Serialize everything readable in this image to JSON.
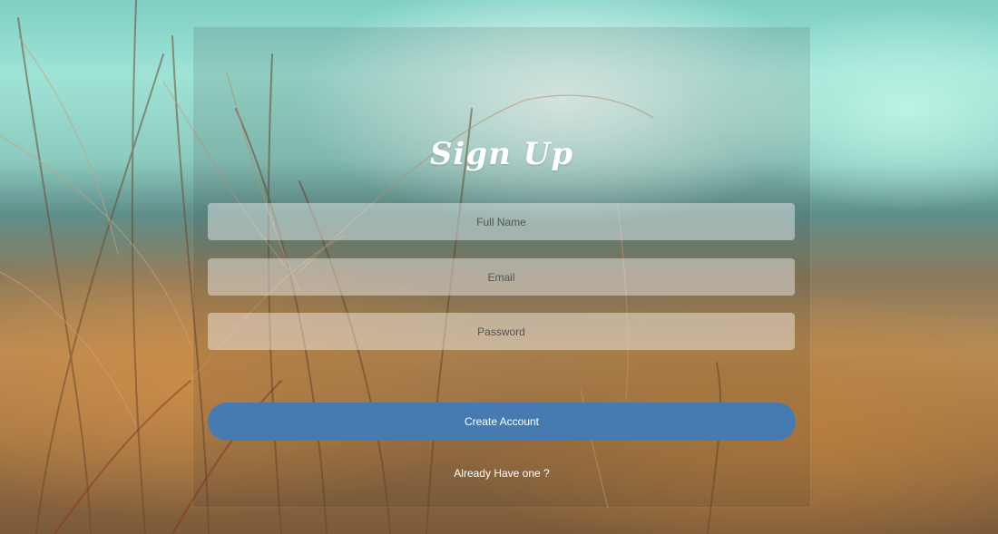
{
  "form": {
    "title": "Sign Up",
    "full_name": {
      "placeholder": "Full Name",
      "value": ""
    },
    "email": {
      "placeholder": "Email",
      "value": ""
    },
    "password": {
      "placeholder": "Password",
      "value": ""
    },
    "submit_label": "Create Account",
    "login_link": "Already Have one ?"
  },
  "colors": {
    "button": "#467bb2",
    "text": "#ffffff"
  }
}
